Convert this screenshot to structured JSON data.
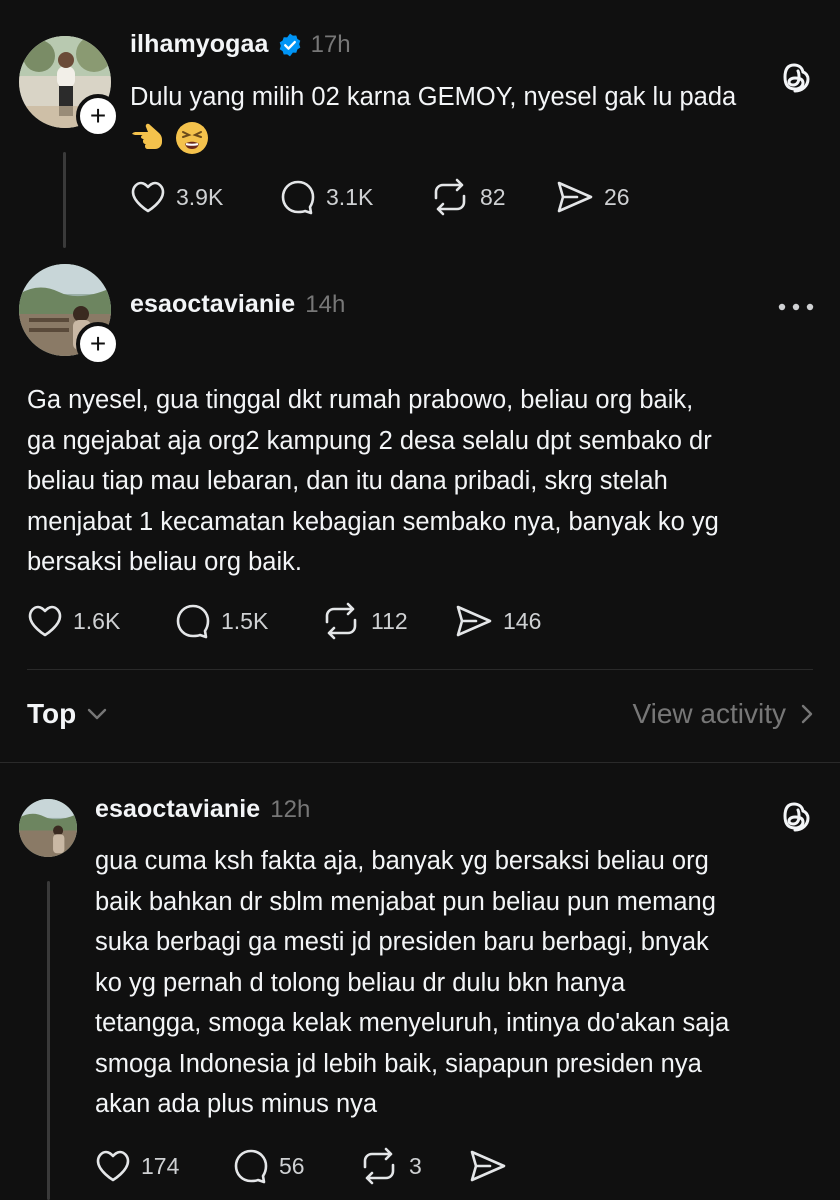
{
  "posts": [
    {
      "username": "ilhamyogaa",
      "verified": true,
      "time": "17h",
      "text": "Dulu yang milih 02 karna GEMOY, nyesel gak lu pada",
      "emojis": [
        "backhand-index-pointing-left",
        "tired-face"
      ],
      "likes": "3.9K",
      "replies": "3.1K",
      "reposts": "82",
      "shares": "26"
    },
    {
      "username": "esaoctavianie",
      "time": "14h",
      "text_lines": [
        "Ga nyesel, gua tinggal dkt rumah prabowo, beliau org baik,",
        "ga ngejabat aja org2 kampung 2 desa selalu dpt sembako dr",
        "beliau tiap mau lebaran, dan itu dana pribadi, skrg stelah",
        "menjabat 1 kecamatan kebagian sembako nya, banyak ko yg",
        "bersaksi beliau org baik."
      ],
      "likes": "1.6K",
      "replies": "1.5K",
      "reposts": "112",
      "shares": "146"
    },
    {
      "username": "esaoctavianie",
      "time": "12h",
      "text_lines": [
        "gua cuma ksh fakta aja, banyak yg bersaksi beliau org",
        "baik bahkan dr sblm menjabat pun beliau pun memang",
        "suka berbagi ga mesti jd presiden baru berbagi, bnyak",
        "ko yg pernah d tolong beliau dr dulu bkn hanya",
        "tetangga, smoga kelak menyeluruh, intinya do'akan saja",
        "smoga Indonesia jd lebih baik, siapapun presiden nya",
        "akan ada plus minus nya"
      ],
      "likes": "174",
      "replies": "56",
      "reposts": "3"
    }
  ],
  "sort_bar": {
    "sort_label": "Top",
    "activity_label": "View activity"
  },
  "icons": {
    "threads": "threads-logo-icon",
    "more": "more-icon",
    "plus": "+"
  },
  "colors": {
    "background": "#101010",
    "text": "#f3f5f7",
    "muted": "#777777",
    "verified": "#0095f6"
  }
}
